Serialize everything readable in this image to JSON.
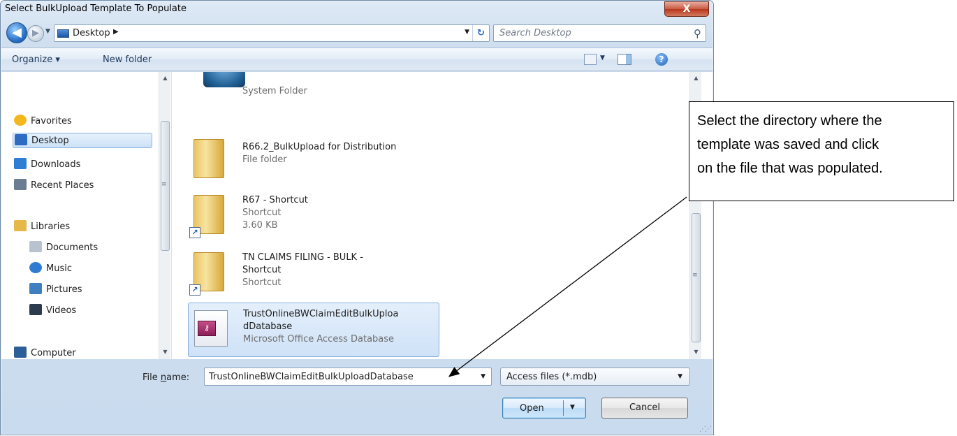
{
  "window": {
    "title": "Select BulkUpload Template To Populate",
    "close_glyph": "X"
  },
  "nav": {
    "address": "Desktop",
    "search_placeholder": "Search Desktop"
  },
  "toolbar": {
    "organize": "Organize ▾",
    "new_folder": "New folder"
  },
  "sidebar": {
    "items": [
      {
        "label": "Favorites",
        "icon": "star-icon",
        "color": "#f2b81e"
      },
      {
        "label": "Desktop",
        "icon": "desktop-icon",
        "color": "#2e6bc2"
      },
      {
        "label": "Downloads",
        "icon": "downloads-icon",
        "color": "#2e7fd3"
      },
      {
        "label": "Recent Places",
        "icon": "recent-places-icon",
        "color": "#6b7d90"
      },
      {
        "label": "Libraries",
        "icon": "libraries-icon",
        "color": "#e5b84a"
      },
      {
        "label": "Documents",
        "icon": "documents-icon",
        "color": "#b8c3cf"
      },
      {
        "label": "Music",
        "icon": "music-icon",
        "color": "#2f7bd4"
      },
      {
        "label": "Pictures",
        "icon": "pictures-icon",
        "color": "#3f7fbf"
      },
      {
        "label": "Videos",
        "icon": "videos-icon",
        "color": "#2c3b4d"
      },
      {
        "label": "Computer",
        "icon": "computer-icon",
        "color": "#2c5f97"
      }
    ]
  },
  "files": [
    {
      "name": "",
      "meta1": "System Folder",
      "meta2": ""
    },
    {
      "name": "R66.2_BulkUpload for Distribution",
      "meta1": "File folder",
      "meta2": ""
    },
    {
      "name": "R67 - Shortcut",
      "meta1": "Shortcut",
      "meta2": "3.60 KB"
    },
    {
      "name": "TN CLAIMS FILING - BULK -",
      "name2": "Shortcut",
      "meta1": "Shortcut"
    },
    {
      "name": "TrustOnlineBWClaimEditBulkUploa",
      "name2": "dDatabase",
      "meta1": "Microsoft Office Access Database"
    }
  ],
  "bottom": {
    "file_name_label_pre": "File ",
    "file_name_label_u": "n",
    "file_name_label_post": "ame:",
    "file_name_value": "TrustOnlineBWClaimEditBulkUploadDatabase",
    "filter_value": "Access files (*.mdb)",
    "open_label": "Open",
    "cancel_label": "Cancel"
  },
  "callout": {
    "line1": "Select the directory where the",
    "line2": "template was saved and click",
    "line3": "on the file that was populated."
  }
}
